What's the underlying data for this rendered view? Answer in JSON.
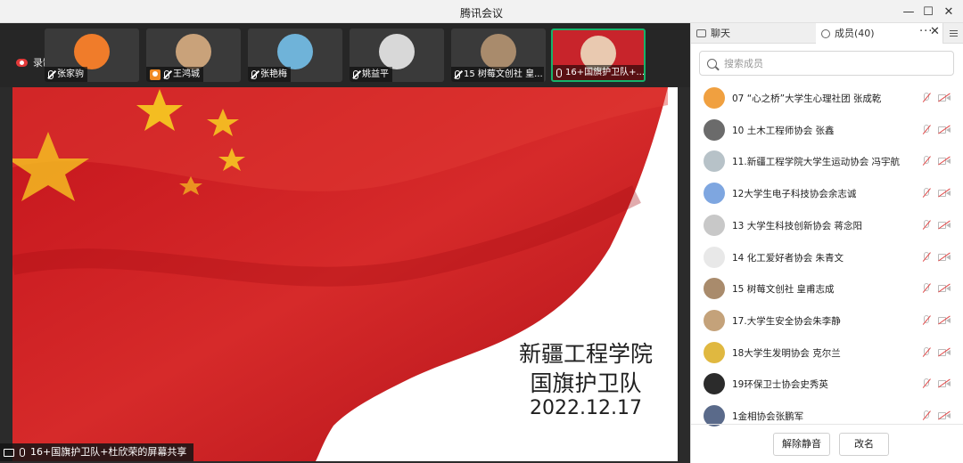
{
  "window": {
    "title": "腾讯会议",
    "minimize": "—",
    "maximize": "☐",
    "close": "✕"
  },
  "recording": {
    "label": "录制中"
  },
  "thumbnails": [
    {
      "name": "张家驹",
      "mic": "muted",
      "avatar_color": "#f07c2a"
    },
    {
      "name": "王鸿城",
      "mic": "person",
      "avatar_color": "#c9a27a"
    },
    {
      "name": "张艳梅",
      "mic": "muted",
      "avatar_color": "#6fb3d9"
    },
    {
      "name": "姚益平",
      "mic": "muted",
      "avatar_color": "#d8d8d8"
    },
    {
      "name": "15 树莓文创社 皇...",
      "mic": "muted",
      "avatar_color": "#a98b6c"
    },
    {
      "name": "16+国旗护卫队+...",
      "mic": "on",
      "avatar_color": "#e9c9b0"
    }
  ],
  "slide": {
    "line1": "新疆工程学院",
    "line2": "国旗护卫队",
    "line3": "2022.12.17"
  },
  "share_label": "16+国旗护卫队+杜欣荣的屏幕共享",
  "panel": {
    "tab_chat": "聊天",
    "tab_members": "成员(40)",
    "more": "···",
    "close": "✕",
    "search_placeholder": "搜索成员",
    "members": [
      {
        "name": "07 “心之桥”大学生心理社团  张成乾",
        "avatar_color": "#f0a040"
      },
      {
        "name": "10 土木工程师协会 张鑫",
        "avatar_color": "#6b6b6b"
      },
      {
        "name": "11.新疆工程学院大学生运动协会 冯宇航",
        "avatar_color": "#b7c2c8"
      },
      {
        "name": "12大学生电子科技协会余志诚",
        "avatar_color": "#7ea6e0"
      },
      {
        "name": "13 大学生科技创新协会 蒋念阳",
        "avatar_color": "#c8c8c8"
      },
      {
        "name": "14 化工爱好者协会 朱青文",
        "avatar_color": "#e8e8e8"
      },
      {
        "name": "15 树莓文创社 皇甫志成",
        "avatar_color": "#a98b6c"
      },
      {
        "name": "17.大学生安全协会朱李静",
        "avatar_color": "#c4a27a"
      },
      {
        "name": "18大学生发明协会 克尔兰",
        "avatar_color": "#e0b840"
      },
      {
        "name": "19环保卫士协会史秀英",
        "avatar_color": "#2b2b2b"
      },
      {
        "name": "1金相协会张鹏军",
        "avatar_color": "#5a6a8a"
      }
    ],
    "btn_mute": "解除静音",
    "btn_rename": "改名"
  }
}
